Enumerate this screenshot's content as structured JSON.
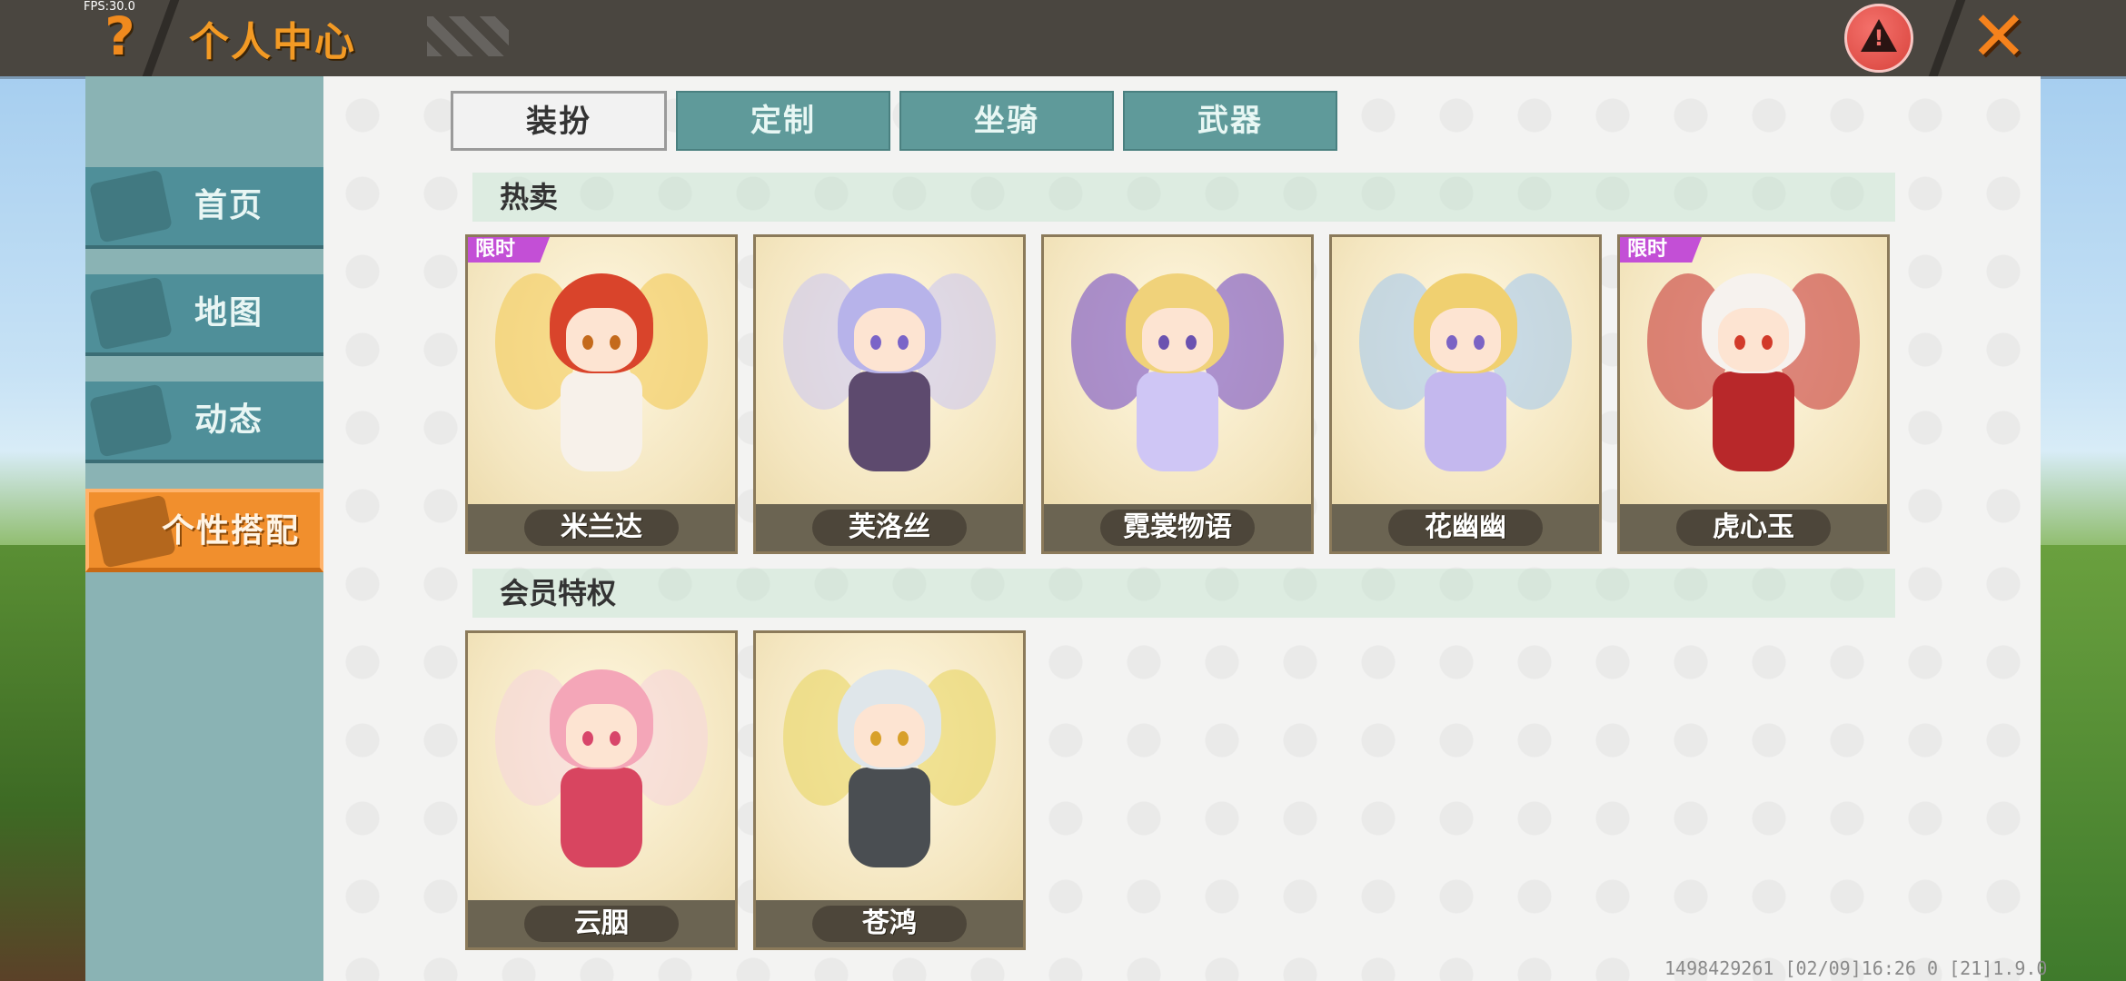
{
  "fps": "FPS:30.0",
  "header": {
    "title": "个人中心",
    "help_icon": "?",
    "close_icon": "✕"
  },
  "sidebar": {
    "items": [
      {
        "label": "首页",
        "icon": "house-icon",
        "active": false
      },
      {
        "label": "地图",
        "icon": "picture-icon",
        "active": false
      },
      {
        "label": "动态",
        "icon": "bell-icon",
        "active": false
      },
      {
        "label": "个性搭配",
        "icon": "outfit-icon",
        "active": true
      }
    ]
  },
  "tabs": [
    {
      "label": "装扮",
      "active": true
    },
    {
      "label": "定制",
      "active": false
    },
    {
      "label": "坐骑",
      "active": false
    },
    {
      "label": "武器",
      "active": false
    }
  ],
  "sections": [
    {
      "title": "热卖",
      "items": [
        {
          "name": "米兰达",
          "badge": "限时",
          "hair": "#d9442b",
          "body": "#f7f1ea",
          "wing": "#f3c64a",
          "eye": "#c46a1c"
        },
        {
          "name": "芙洛丝",
          "badge": "",
          "hair": "#b7b3ea",
          "body": "#5d4a6e",
          "wing": "#c9c4f2",
          "eye": "#7a64c8"
        },
        {
          "name": "霓裳物语",
          "badge": "",
          "hair": "#f0d27a",
          "body": "#cfc6f5",
          "wing": "#6a3fc4",
          "eye": "#6b52b0"
        },
        {
          "name": "花幽幽",
          "badge": "",
          "hair": "#f0d070",
          "body": "#c4b8ee",
          "wing": "#9fc6f0",
          "eye": "#7b63c4"
        },
        {
          "name": "虎心玉",
          "badge": "限时",
          "hair": "#f6f2ee",
          "body": "#b8282a",
          "wing": "#c22a2a",
          "eye": "#d23a2a"
        }
      ]
    },
    {
      "title": "会员特权",
      "items": [
        {
          "name": "云胭",
          "badge": "",
          "hair": "#f4a6b8",
          "body": "#d84560",
          "wing": "#f6d4dc",
          "eye": "#d8466a"
        },
        {
          "name": "苍鸿",
          "badge": "",
          "hair": "#dfe6ea",
          "body": "#4a4e52",
          "wing": "#e8d45a",
          "eye": "#d8a02a"
        }
      ]
    }
  ],
  "footer": "1498429261    [02/09]16:26 0  [21]1.9.0"
}
